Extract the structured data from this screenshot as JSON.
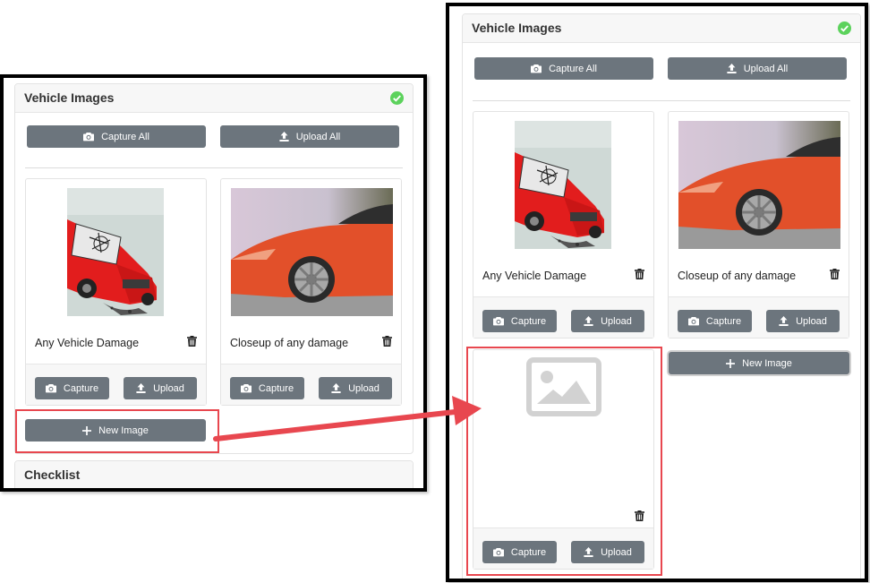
{
  "vehicle_images": {
    "title": "Vehicle Images",
    "capture_all_label": "Capture All",
    "upload_all_label": "Upload All",
    "new_image_label": "New Image",
    "images": [
      {
        "label": "Any Vehicle Damage"
      },
      {
        "label": "Closeup of any damage"
      }
    ],
    "capture_label": "Capture",
    "upload_label": "Upload"
  },
  "checklist": {
    "title": "Checklist"
  },
  "colors": {
    "button": "#6c757d",
    "success": "#5cd25c",
    "highlight": "#e8474f",
    "header_bg": "#f7f7f7"
  },
  "icons": [
    "check-circle-icon",
    "camera-icon",
    "upload-icon",
    "plus-icon",
    "trash-icon",
    "image-placeholder-icon",
    "arrow-icon"
  ]
}
